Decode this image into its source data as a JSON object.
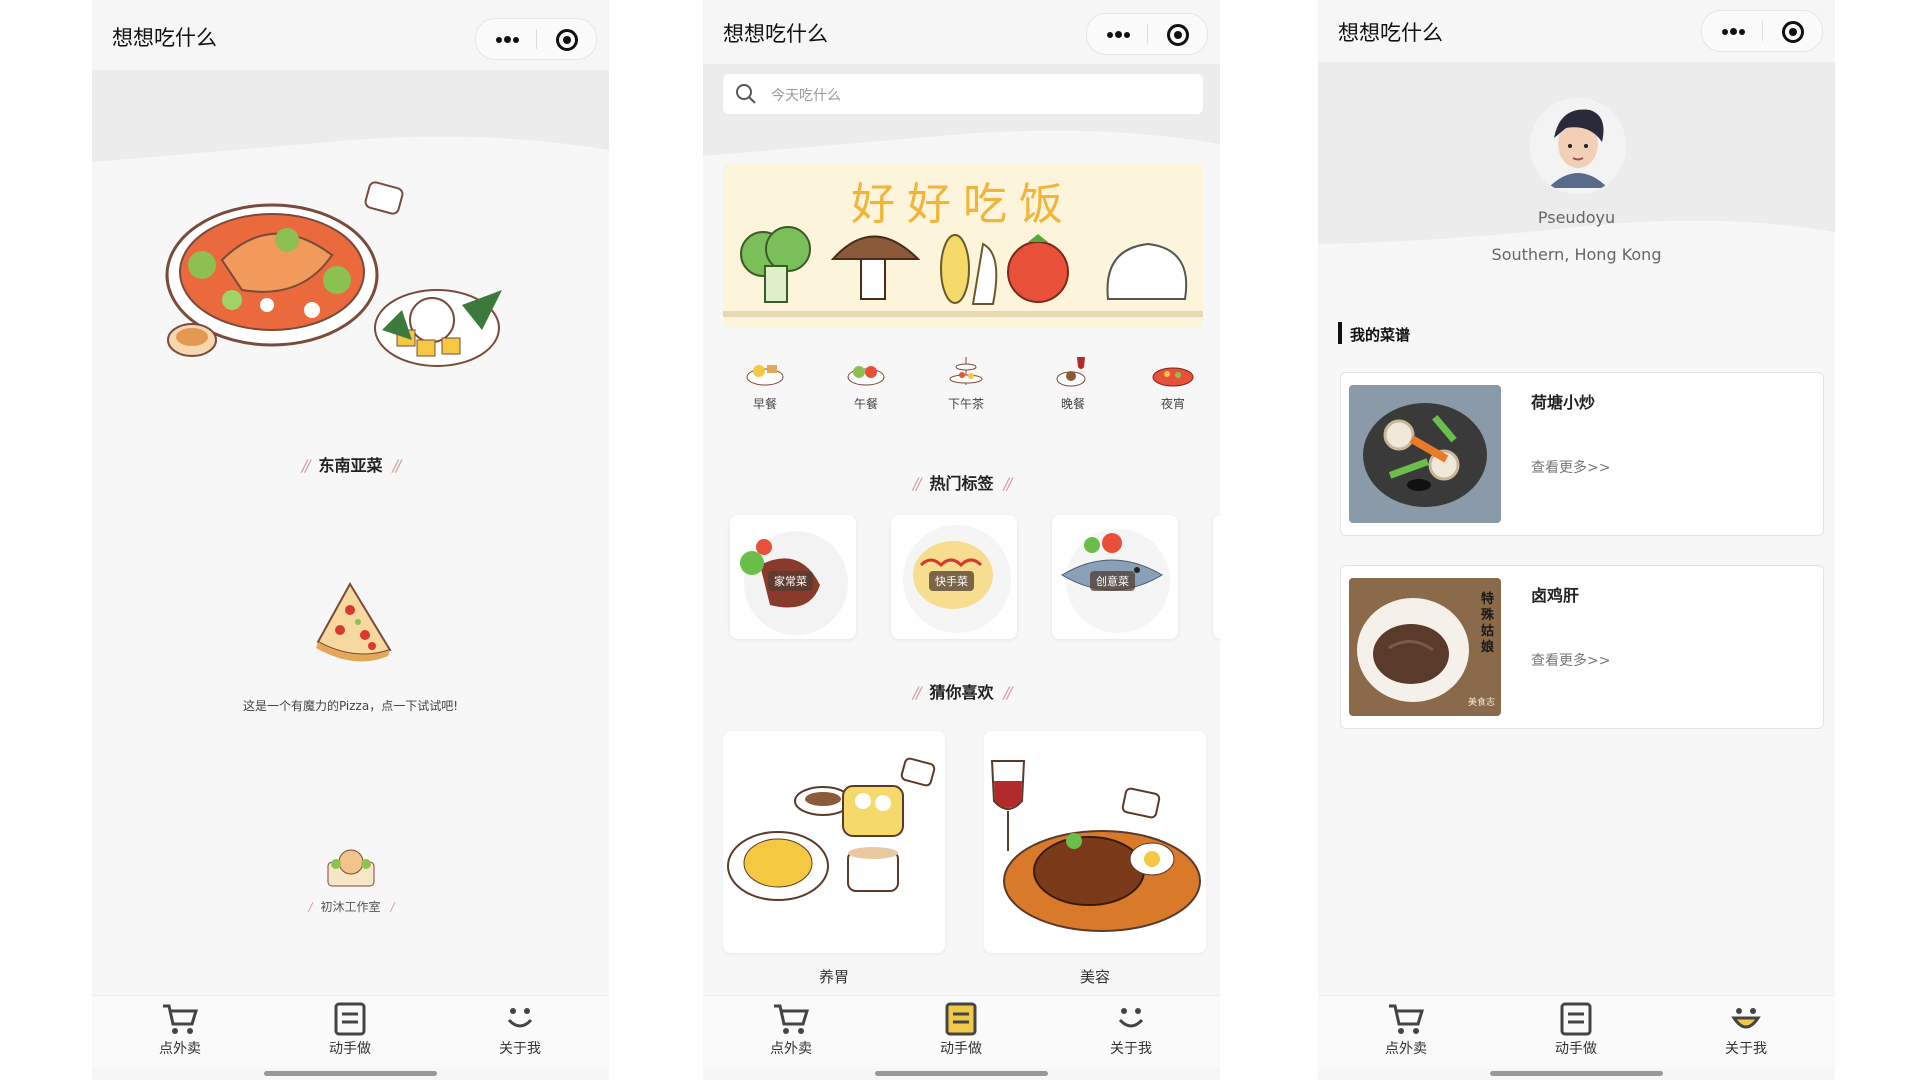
{
  "app_title": "想想吃什么",
  "tabs": [
    "点外卖",
    "动手做",
    "关于我"
  ],
  "screen1": {
    "section_title": "东南亚菜",
    "hint": "这是一个有魔力的Pizza，点一下试试吧!",
    "studio": "初沐工作室"
  },
  "screen2": {
    "search_placeholder": "今天吃什么",
    "banner_text": "好好吃饭",
    "categories": [
      "早餐",
      "午餐",
      "下午茶",
      "晚餐",
      "夜宵"
    ],
    "hot_tags_title": "热门标签",
    "hot_tags": [
      "家常菜",
      "快手菜",
      "创意菜"
    ],
    "guess_title": "猜你喜欢",
    "guess_items": [
      "养胃",
      "美容"
    ]
  },
  "screen3": {
    "username": "Pseudoyu",
    "location": "Southern, Hong Kong",
    "my_recipes_title": "我的菜谱",
    "recipes": [
      {
        "title": "荷塘小炒",
        "more": "查看更多>>"
      },
      {
        "title": "卤鸡肝",
        "more": "查看更多>>",
        "image_text": "特殊姑娘",
        "image_caption": "美食志"
      }
    ]
  },
  "colors": {
    "accent": "#f0c94a",
    "slash": "#d5a2a2",
    "background": "#f7f7f7"
  }
}
